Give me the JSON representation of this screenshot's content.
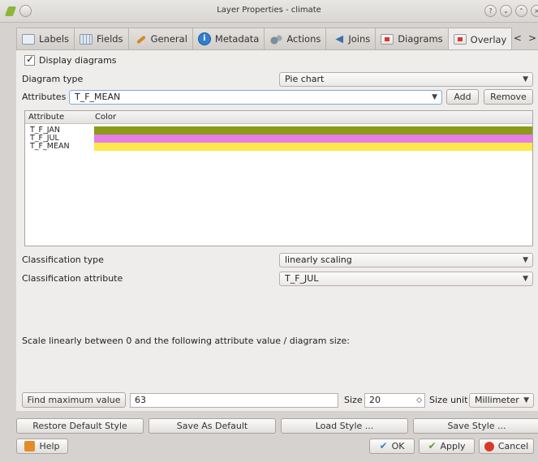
{
  "window": {
    "title": "Layer Properties - climate",
    "controls": [
      "?",
      "⌄",
      "⌃",
      "×"
    ]
  },
  "tabs": [
    {
      "label": "Labels",
      "icon": "labels-icon"
    },
    {
      "label": "Fields",
      "icon": "fields-icon"
    },
    {
      "label": "General",
      "icon": "general-icon"
    },
    {
      "label": "Metadata",
      "icon": "metadata-icon"
    },
    {
      "label": "Actions",
      "icon": "actions-icon"
    },
    {
      "label": "Joins",
      "icon": "joins-icon"
    },
    {
      "label": "Diagrams",
      "icon": "diagrams-icon"
    },
    {
      "label": "Overlay",
      "icon": "overlay-icon"
    }
  ],
  "tab_scroll": {
    "left": "<",
    "right": ">"
  },
  "overlay": {
    "display_diagrams_label": "Display diagrams",
    "diagram_type_label": "Diagram type",
    "diagram_type_value": "Pie chart",
    "attributes_label": "Attributes",
    "attributes_value": "T_F_MEAN",
    "add_label": "Add",
    "remove_label": "Remove",
    "table": {
      "headers": [
        "Attribute",
        "Color"
      ],
      "rows": [
        {
          "name": "T_F_JAN",
          "color": "#8b9a1a"
        },
        {
          "name": "T_F_JUL",
          "color": "#e57ee6"
        },
        {
          "name": "T_F_MEAN",
          "color": "#ffe84a"
        }
      ]
    },
    "classification_type_label": "Classification type",
    "classification_type_value": "linearly scaling",
    "classification_attribute_label": "Classification attribute",
    "classification_attribute_value": "T_F_JUL",
    "scale_text": "Scale linearly between 0 and the following attribute value / diagram size:",
    "find_max_label": "Find maximum value",
    "max_value": "63",
    "size_label": "Size",
    "size_value": "20",
    "size_unit_label": "Size unit",
    "size_unit_value": "Millimeter"
  },
  "style_buttons": {
    "restore": "Restore Default Style",
    "save_default": "Save As Default",
    "load": "Load Style ...",
    "save": "Save Style ..."
  },
  "dialog": {
    "help": "Help",
    "ok": "OK",
    "apply": "Apply",
    "cancel": "Cancel"
  }
}
